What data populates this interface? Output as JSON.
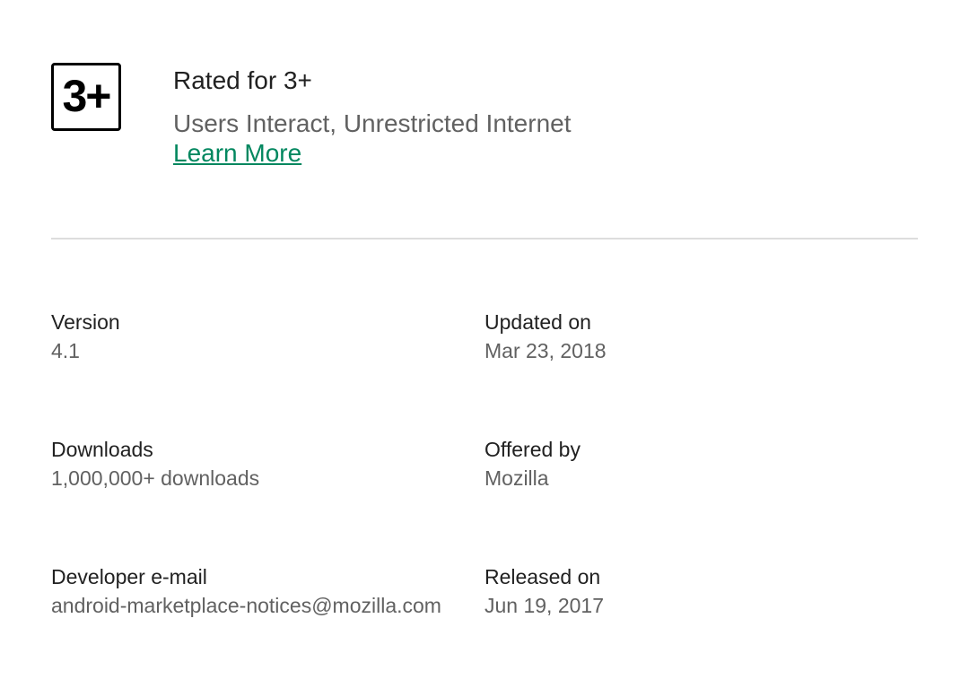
{
  "rating": {
    "badge_text": "3+",
    "title": "Rated for 3+",
    "descriptors": "Users Interact, Unrestricted Internet",
    "learn_more_label": "Learn More"
  },
  "info": {
    "version": {
      "label": "Version",
      "value": "4.1"
    },
    "updated_on": {
      "label": "Updated on",
      "value": "Mar 23, 2018"
    },
    "downloads": {
      "label": "Downloads",
      "value": "1,000,000+ downloads"
    },
    "offered_by": {
      "label": "Offered by",
      "value": "Mozilla"
    },
    "developer_email": {
      "label": "Developer e-mail",
      "value": "android-marketplace-notices@mozilla.com"
    },
    "released_on": {
      "label": "Released on",
      "value": "Jun 19, 2017"
    }
  },
  "colors": {
    "link": "#01875f",
    "primary_text": "#212121",
    "secondary_text": "#616161",
    "divider": "#dddddd"
  }
}
